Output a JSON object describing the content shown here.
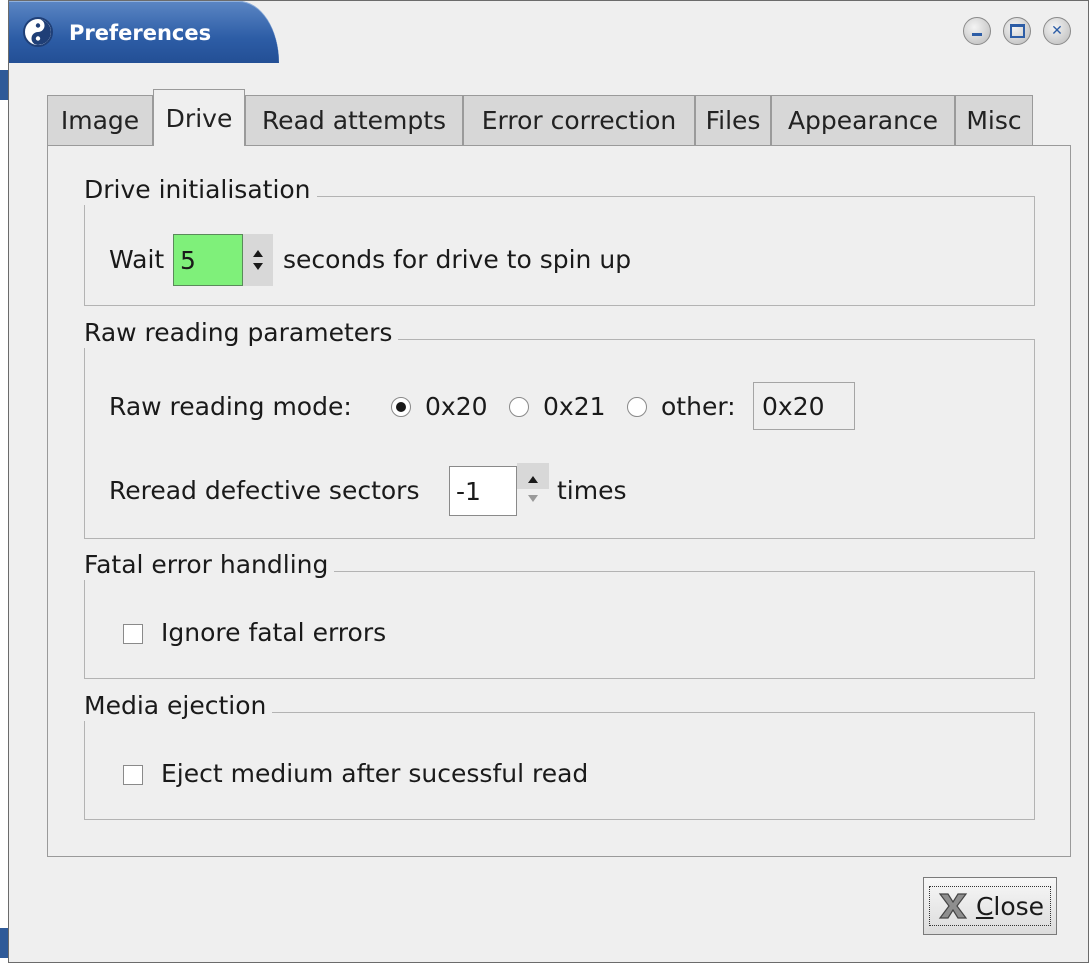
{
  "window": {
    "title": "Preferences",
    "controls": [
      "minimize",
      "maximize",
      "close"
    ]
  },
  "tabs": [
    {
      "label": "Image"
    },
    {
      "label": "Drive",
      "active": true
    },
    {
      "label": "Read attempts"
    },
    {
      "label": "Error correction"
    },
    {
      "label": "Files"
    },
    {
      "label": "Appearance"
    },
    {
      "label": "Misc"
    }
  ],
  "drive_init": {
    "title": "Drive initialisation",
    "wait_label": "Wait",
    "wait_value": "5",
    "wait_suffix": "seconds for drive to spin up",
    "wait_field_color": "#7ff07a"
  },
  "raw_reading": {
    "title": "Raw reading parameters",
    "mode_label": "Raw reading mode:",
    "options": [
      "0x20",
      "0x21",
      "other:"
    ],
    "selected": "0x20",
    "other_value": "0x20",
    "reread_label": "Reread defective sectors",
    "reread_value": "-1",
    "reread_suffix": "times"
  },
  "fatal_error": {
    "title": "Fatal error handling",
    "checkbox_label": "Ignore fatal errors",
    "checked": false
  },
  "media_ejection": {
    "title": "Media ejection",
    "checkbox_label": "Eject medium after sucessful read",
    "checked": false
  },
  "buttons": {
    "close_label": "Close",
    "close_mnemonic": "C",
    "close_rest": "lose"
  }
}
